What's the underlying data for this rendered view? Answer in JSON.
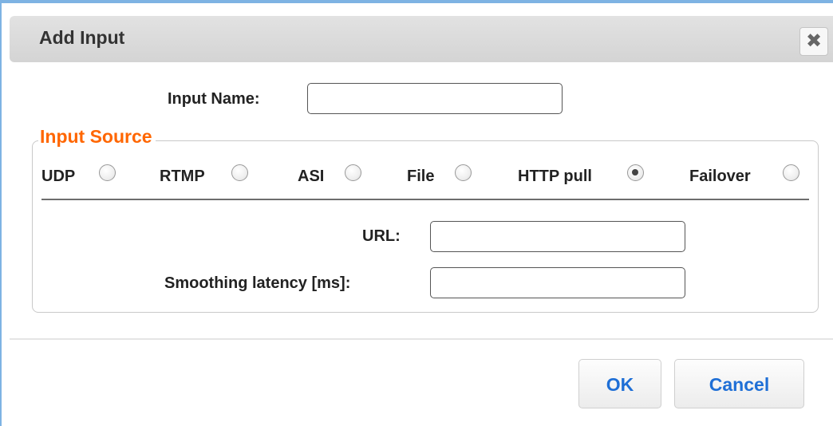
{
  "dialog": {
    "title": "Add Input",
    "close_icon": "close-icon",
    "close_glyph": "✖"
  },
  "input_name": {
    "label": "Input Name:",
    "value": "",
    "placeholder": ""
  },
  "input_source": {
    "legend": "Input Source",
    "selected": "HTTP pull",
    "options": [
      {
        "label": "UDP",
        "checked": false
      },
      {
        "label": "RTMP",
        "checked": false
      },
      {
        "label": "ASI",
        "checked": false
      },
      {
        "label": "File",
        "checked": false
      },
      {
        "label": "HTTP pull",
        "checked": true
      },
      {
        "label": "Failover",
        "checked": false
      }
    ],
    "url": {
      "label": "URL:",
      "value": "",
      "placeholder": ""
    },
    "smoothing_latency": {
      "label": "Smoothing latency [ms]:",
      "value": "",
      "placeholder": ""
    }
  },
  "buttons": {
    "ok": "OK",
    "cancel": "Cancel"
  },
  "colors": {
    "legend": "#ff6600",
    "button_text": "#1f6fd6",
    "frame_border": "#7eb3e3"
  }
}
